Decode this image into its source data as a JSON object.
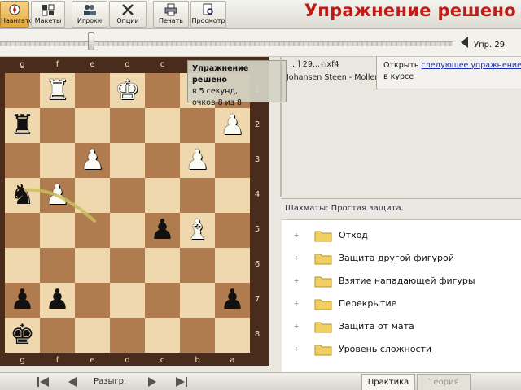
{
  "toolbar": {
    "buttons": [
      {
        "label": "Навигатор",
        "icon": "compass-icon",
        "active": true
      },
      {
        "label": "Макеты",
        "icon": "layouts-icon",
        "active": false
      },
      {
        "label": "Игроки",
        "icon": "players-icon",
        "active": false
      },
      {
        "label": "Опции",
        "icon": "tools-icon",
        "active": false
      },
      {
        "label": "Печать",
        "icon": "printer-icon",
        "active": false
      },
      {
        "label": "Просмотр",
        "icon": "preview-icon",
        "active": false
      }
    ],
    "title": "Упражнение решено"
  },
  "navigator": {
    "exercise_label": "Упр. 29"
  },
  "board": {
    "files": [
      "g",
      "f",
      "e",
      "d",
      "c",
      "b",
      "a"
    ],
    "ranks": [
      "1",
      "2",
      "3",
      "4",
      "5",
      "6",
      "7",
      "8"
    ],
    "pieces": [
      {
        "square": "f1",
        "glyph": "♜",
        "color": "white",
        "name": "white-rook"
      },
      {
        "square": "d1",
        "glyph": "♚",
        "color": "white",
        "name": "white-king"
      },
      {
        "square": "g2",
        "glyph": "♜",
        "color": "black",
        "name": "black-rook"
      },
      {
        "square": "a2",
        "glyph": "♟",
        "color": "white",
        "name": "white-pawn"
      },
      {
        "square": "e3",
        "glyph": "♟",
        "color": "white",
        "name": "white-pawn"
      },
      {
        "square": "b3",
        "glyph": "♟",
        "color": "white",
        "name": "white-pawn"
      },
      {
        "square": "g4",
        "glyph": "♞",
        "color": "black",
        "name": "black-knight"
      },
      {
        "square": "f4",
        "glyph": "♟",
        "color": "white",
        "name": "white-pawn"
      },
      {
        "square": "c5",
        "glyph": "♟",
        "color": "black",
        "name": "black-pawn"
      },
      {
        "square": "b5",
        "glyph": "♝",
        "color": "white",
        "name": "white-bishop"
      },
      {
        "square": "g7",
        "glyph": "♟",
        "color": "black",
        "name": "black-pawn"
      },
      {
        "square": "f7",
        "glyph": "♟",
        "color": "black",
        "name": "black-pawn"
      },
      {
        "square": "a7",
        "glyph": "♟",
        "color": "black",
        "name": "black-pawn"
      },
      {
        "square": "g8",
        "glyph": "♚",
        "color": "black",
        "name": "black-king"
      }
    ]
  },
  "tooltip": {
    "title": "Упражнение решено",
    "line1": "в 5 секунд,",
    "line2": "очков 8 из 8"
  },
  "notation": {
    "moves": "...] 29...♘xf4",
    "players": "Johansen Steen - Moller Birger, Aarhus Vejle"
  },
  "next_exercise": {
    "text_prefix": "Открыть ",
    "link": "следующее упражнение",
    "text_suffix": "в курсе"
  },
  "course": {
    "header": "Шахматы: Простая защита.",
    "items": [
      "Отход",
      "Защита другой фигурой",
      "Взятие нападающей фигуры",
      "Перекрытие",
      "Защита от мата",
      "Уровень сложности"
    ]
  },
  "bottom": {
    "play_label": "Разыгр.",
    "tabs": [
      {
        "label": "Практика",
        "active": true
      },
      {
        "label": "Теория",
        "active": false
      }
    ]
  },
  "colors": {
    "title": "#c21a14",
    "board_light": "#efd8ae",
    "board_dark": "#b07c4f",
    "frame": "#4a2c1c",
    "link": "#1a2fb0"
  }
}
